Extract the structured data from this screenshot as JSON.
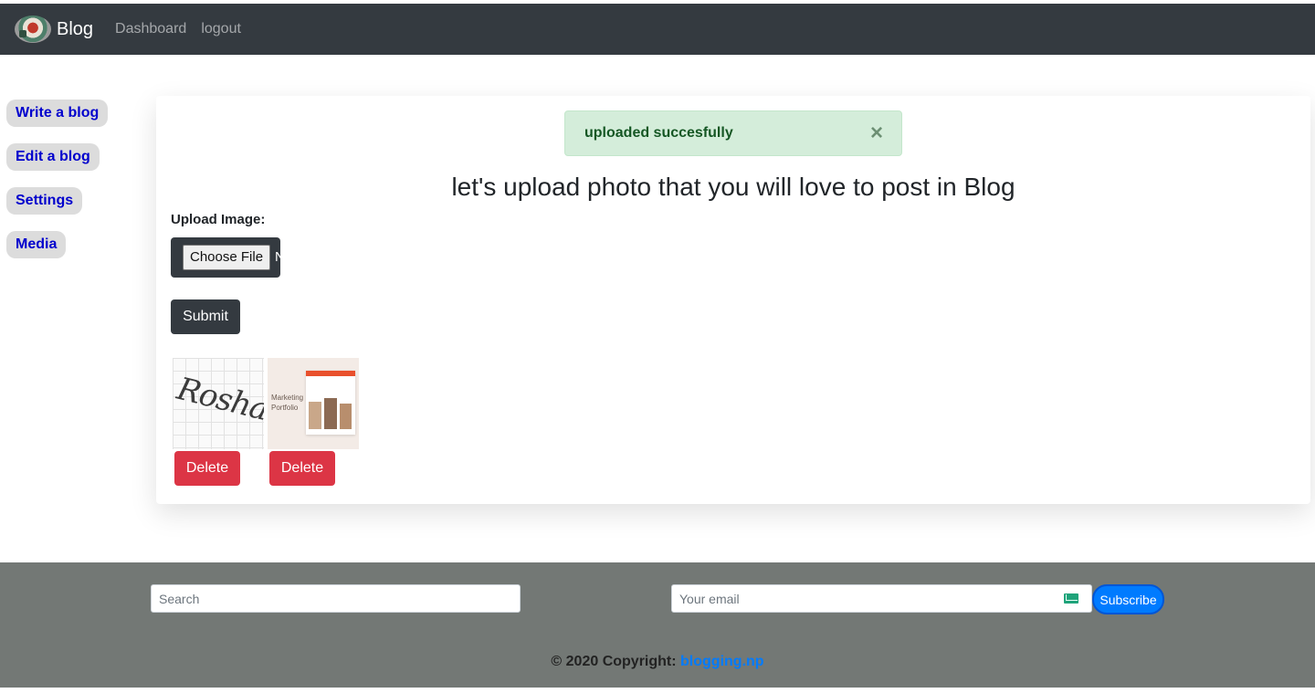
{
  "navbar": {
    "brand": "Blog",
    "links": [
      "Dashboard",
      "logout"
    ]
  },
  "sidebar": {
    "items": [
      "Write a blog",
      "Edit a blog",
      "Settings",
      "Media"
    ]
  },
  "alert": {
    "message": "uploaded succesfully",
    "close": "×"
  },
  "main": {
    "title": "let's upload photo that you will love to post in Blog",
    "upload_label": "Upload Image:",
    "choose_file": "Choose File",
    "file_status": "N",
    "submit": "Submit",
    "images": [
      {
        "handwriting": "Roshan",
        "delete": "Delete"
      },
      {
        "caption": "Marketing Portfolio",
        "delete": "Delete"
      }
    ]
  },
  "footer": {
    "search_placeholder": "Search",
    "email_placeholder": "Your email",
    "subscribe": "Subscribe",
    "copyright_prefix": "© 2020 Copyright:",
    "copyright_link": "blogging.np"
  },
  "colors": {
    "navbar": "#343a40",
    "alert_bg": "#d4edda",
    "delete": "#dc3545",
    "footer": "#737875",
    "accent": "#007bff",
    "sidebar_text": "#0000cd"
  },
  "icons": [
    "brand-logo",
    "close-icon",
    "mail-icon"
  ]
}
